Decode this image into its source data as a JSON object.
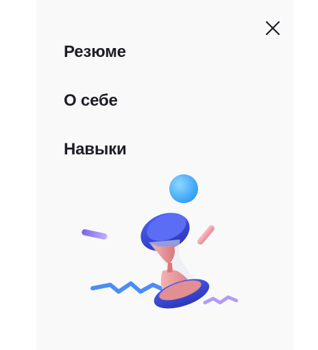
{
  "menu": {
    "items": [
      {
        "label": "Резюме"
      },
      {
        "label": "О себе"
      },
      {
        "label": "Навыки"
      }
    ]
  },
  "icons": {
    "close": "close-icon",
    "illustration": "hourglass-illustration"
  },
  "colors": {
    "panel_background": "#f9f9fa",
    "text": "#1d1d26",
    "hourglass_blue": "#3d4fe0",
    "hourglass_pink": "#e59a9c",
    "sphere_blue": "#4fb8ff",
    "accent_purple": "#9a7ef0"
  }
}
